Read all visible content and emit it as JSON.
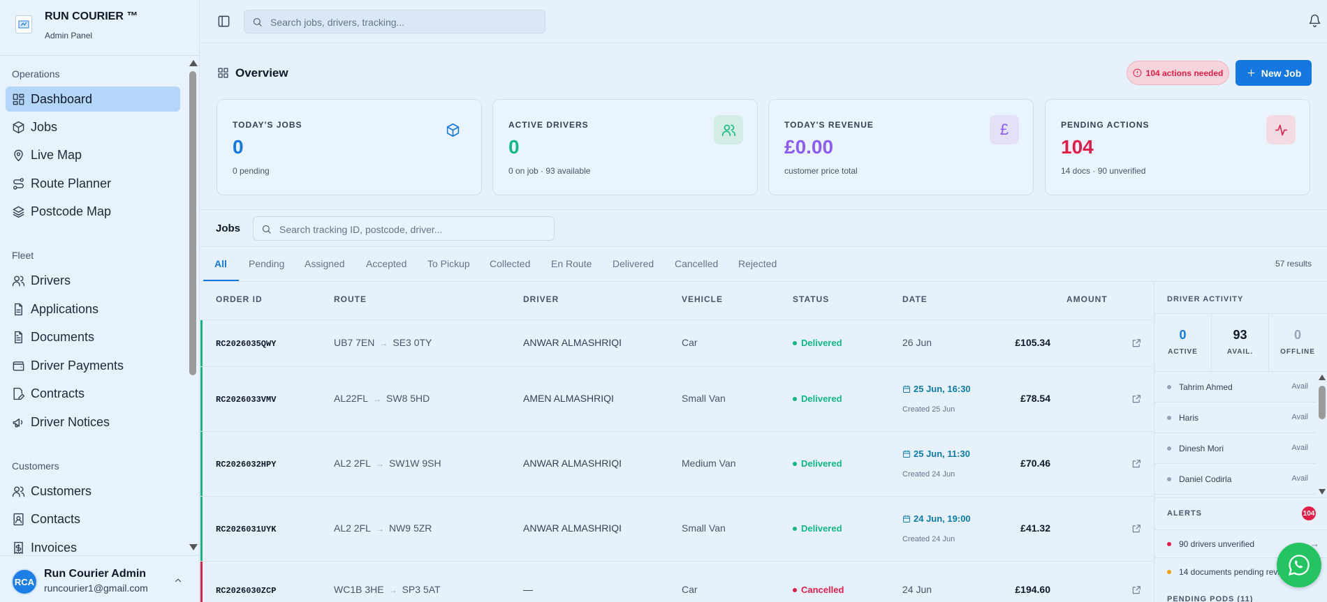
{
  "brand": {
    "name": "RUN COURIER ™",
    "subtitle": "Admin Panel"
  },
  "sidebar": {
    "sections": [
      {
        "title": "Operations",
        "items": [
          {
            "label": "Dashboard",
            "icon": "dashboard-icon",
            "active": true
          },
          {
            "label": "Jobs",
            "icon": "package-icon"
          },
          {
            "label": "Live Map",
            "icon": "map-pin-icon"
          },
          {
            "label": "Route Planner",
            "icon": "route-icon"
          },
          {
            "label": "Postcode Map",
            "icon": "layers-icon"
          }
        ]
      },
      {
        "title": "Fleet",
        "items": [
          {
            "label": "Drivers",
            "icon": "users-icon"
          },
          {
            "label": "Applications",
            "icon": "file-icon"
          },
          {
            "label": "Documents",
            "icon": "file-text-icon"
          },
          {
            "label": "Driver Payments",
            "icon": "wallet-icon"
          },
          {
            "label": "Contracts",
            "icon": "file-edit-icon"
          },
          {
            "label": "Driver Notices",
            "icon": "megaphone-icon"
          }
        ]
      },
      {
        "title": "Customers",
        "items": [
          {
            "label": "Customers",
            "icon": "users-icon"
          },
          {
            "label": "Contacts",
            "icon": "contact-icon"
          },
          {
            "label": "Invoices",
            "icon": "invoice-icon"
          }
        ]
      }
    ],
    "user": {
      "initials": "RCA",
      "name": "Run Courier Admin",
      "email": "runcourier1@gmail.com"
    }
  },
  "topbar": {
    "search_placeholder": "Search jobs, drivers, tracking..."
  },
  "overview": {
    "title": "Overview",
    "actions_badge": "104 actions needed",
    "new_job_label": "New Job",
    "cards": [
      {
        "label": "TODAY'S JOBS",
        "value": "0",
        "sub": "0 pending",
        "color": "#1578e0",
        "icon": "package-icon"
      },
      {
        "label": "ACTIVE DRIVERS",
        "value": "0",
        "sub": "0 on job · 93 available",
        "color": "#10b981",
        "icon": "users-icon"
      },
      {
        "label": "TODAY'S REVENUE",
        "value": "£0.00",
        "sub": "customer price total",
        "color": "#8b5cf6",
        "icon": "pound-icon"
      },
      {
        "label": "PENDING ACTIONS",
        "value": "104",
        "sub": "14 docs · 90 unverified",
        "color": "#e11d48",
        "icon": "activity-icon"
      }
    ]
  },
  "jobs": {
    "title": "Jobs",
    "search_placeholder": "Search tracking ID, postcode, driver...",
    "tabs": [
      "All",
      "Pending",
      "Assigned",
      "Accepted",
      "To Pickup",
      "Collected",
      "En Route",
      "Delivered",
      "Cancelled",
      "Rejected"
    ],
    "active_tab": "All",
    "results": "57 results",
    "columns": [
      "ORDER ID",
      "ROUTE",
      "DRIVER",
      "VEHICLE",
      "STATUS",
      "DATE",
      "AMOUNT"
    ],
    "rows": [
      {
        "order_id": "RC2026035QWY",
        "from": "UB7 7EN",
        "to": "SE3 0TY",
        "driver": "ANWAR ALMASHRIQI",
        "vehicle": "Car",
        "status": "Delivered",
        "date": "26 Jun",
        "scheduled": "",
        "created": "",
        "amount": "£105.34"
      },
      {
        "order_id": "RC2026033VMV",
        "from": "AL22FL",
        "to": "SW8 5HD",
        "driver": "AMEN ALMASHRIQI",
        "vehicle": "Small Van",
        "status": "Delivered",
        "date": "",
        "scheduled": "25 Jun, 16:30",
        "created": "Created 25 Jun",
        "amount": "£78.54"
      },
      {
        "order_id": "RC2026032HPY",
        "from": "AL2 2FL",
        "to": "SW1W 9SH",
        "driver": "ANWAR ALMASHRIQI",
        "vehicle": "Medium Van",
        "status": "Delivered",
        "date": "",
        "scheduled": "25 Jun, 11:30",
        "created": "Created 24 Jun",
        "amount": "£70.46"
      },
      {
        "order_id": "RC2026031UYK",
        "from": "AL2 2FL",
        "to": "NW9 5ZR",
        "driver": "ANWAR ALMASHRIQI",
        "vehicle": "Small Van",
        "status": "Delivered",
        "date": "",
        "scheduled": "24 Jun, 19:00",
        "created": "Created 24 Jun",
        "amount": "£41.32"
      },
      {
        "order_id": "RC2026030ZCP",
        "from": "WC1B 3HE",
        "to": "SP3 5AT",
        "driver": "—",
        "vehicle": "Car",
        "status": "Cancelled",
        "date": "24 Jun",
        "scheduled": "",
        "created": "",
        "amount": "£194.60"
      }
    ]
  },
  "driver_activity": {
    "title": "DRIVER ACTIVITY",
    "stats": [
      {
        "value": "0",
        "label": "ACTIVE",
        "color": "#1578e0"
      },
      {
        "value": "93",
        "label": "AVAIL.",
        "color": "#0f172a"
      },
      {
        "value": "0",
        "label": "OFFLINE",
        "color": "#94a3b8"
      }
    ],
    "drivers": [
      {
        "name": "Tahrim Ahmed",
        "status": "Avail"
      },
      {
        "name": "Haris",
        "status": "Avail"
      },
      {
        "name": "Dinesh Mori",
        "status": "Avail"
      },
      {
        "name": "Daniel Codirla",
        "status": "Avail"
      }
    ]
  },
  "alerts": {
    "title": "ALERTS",
    "count": "104",
    "items": [
      {
        "text": "90 drivers unverified",
        "color": "#e11d48"
      },
      {
        "text": "14 documents pending review",
        "color": "#f59e0b"
      }
    ],
    "next_section": "PENDING PODS (11)"
  }
}
